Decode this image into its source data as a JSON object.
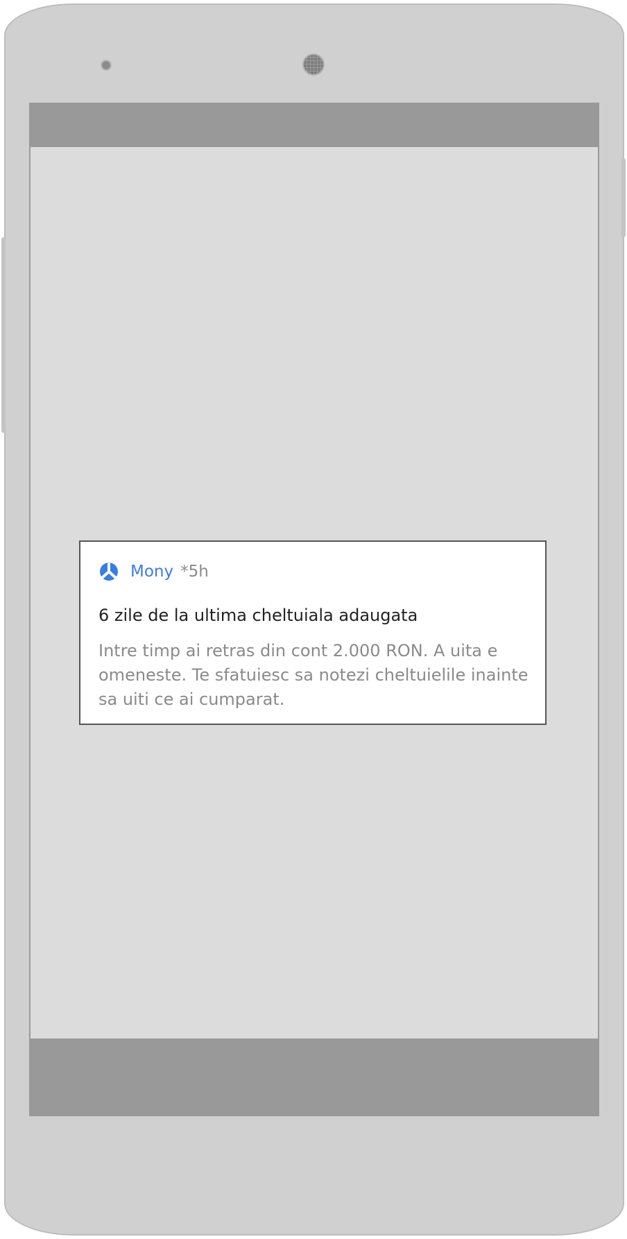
{
  "notification": {
    "app_icon": "tripod-logo-icon",
    "app_name": "Mony",
    "time": "*5h",
    "title": "6 zile de la ultima cheltuiala adaugata",
    "body": "Intre timp ai retras din cont 2.000 RON. A uita e omeneste. Te sfatuiesc sa notezi cheltuielile inainte sa uiti ce ai cumparat."
  },
  "colors": {
    "accent": "#3a7de0",
    "screen_bg": "#dcdcdc",
    "system_bar": "#999999",
    "phone_body": "#d0d0d0"
  }
}
